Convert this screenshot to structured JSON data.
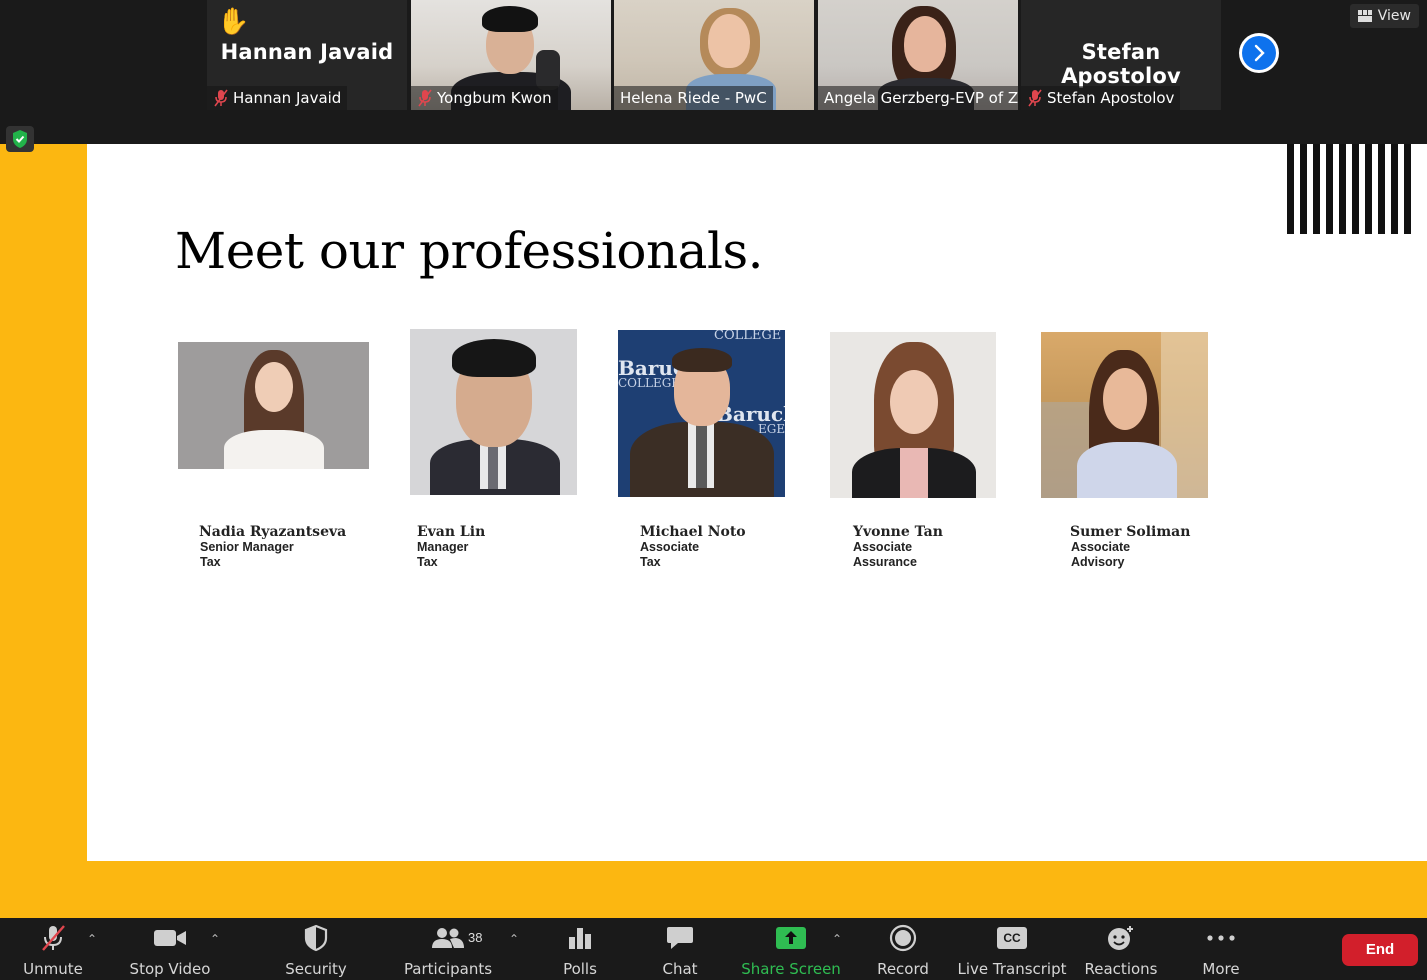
{
  "participants": [
    {
      "display": "Hannan Javaid",
      "label": "Hannan Javaid",
      "muted": true,
      "hand_raised": true,
      "video": false
    },
    {
      "label": "Yongbum Kwon",
      "muted": true,
      "video": true
    },
    {
      "label": "Helena Riede - PwC",
      "muted": false,
      "video": true
    },
    {
      "label": "Angela Gerzberg-EVP of Z...",
      "muted": false,
      "video": true,
      "active_speaker": true
    },
    {
      "display": "Stefan Apostolov",
      "label": "Stefan Apostolov",
      "muted": true,
      "video": false
    }
  ],
  "view_button": "View",
  "slide": {
    "title": "Meet our professionals.",
    "professionals": [
      {
        "name": "Nadia Ryazantseva",
        "role": "Senior Manager",
        "dept": "Tax"
      },
      {
        "name": "Evan Lin",
        "role": "Manager",
        "dept": "Tax"
      },
      {
        "name": "Michael Noto",
        "role": "Associate",
        "dept": "Tax"
      },
      {
        "name": "Yvonne Tan",
        "role": "Associate",
        "dept": "Assurance"
      },
      {
        "name": "Sumer Soliman",
        "role": "Associate",
        "dept": "Advisory"
      }
    ],
    "photo_text": {
      "college_top": "COLLEGE",
      "baruch": "Baruch",
      "college": "COLLEGE",
      "baruch2": "Baruch",
      "ege": "EGE"
    },
    "colors": {
      "frame": "#fcb711",
      "background": "#ffffff"
    }
  },
  "toolbar": {
    "unmute": "Unmute",
    "stop_video": "Stop Video",
    "security": "Security",
    "participants": "Participants",
    "participant_count": "38",
    "polls": "Polls",
    "chat": "Chat",
    "share_screen": "Share Screen",
    "record": "Record",
    "live_transcript": "Live Transcript",
    "cc": "CC",
    "reactions": "Reactions",
    "more": "More",
    "end": "End"
  },
  "colors": {
    "accent_blue": "#0e72ed",
    "share_green": "#2fbd52",
    "end_red": "#d21f2b",
    "muted_red": "#e0464e"
  }
}
